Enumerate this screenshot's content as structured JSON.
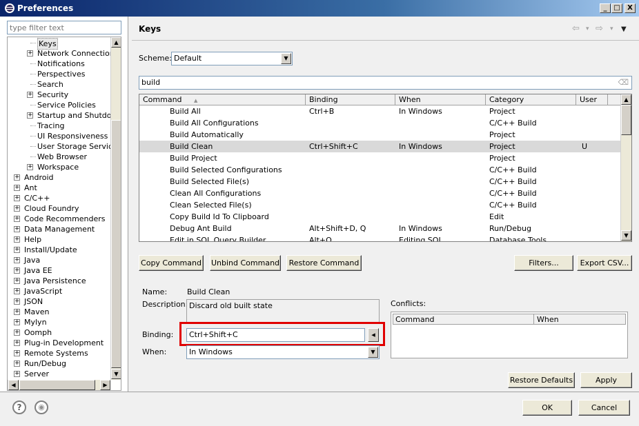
{
  "window": {
    "title": "Preferences",
    "min_label": "_",
    "max_label": "□",
    "close_label": "X"
  },
  "filter": {
    "placeholder": "type filter text"
  },
  "tree": {
    "items": [
      {
        "label": "Keys",
        "level": 2,
        "expander": "",
        "selected": true
      },
      {
        "label": "Network Connections",
        "level": 2,
        "expander": "+"
      },
      {
        "label": "Notifications",
        "level": 2,
        "expander": ""
      },
      {
        "label": "Perspectives",
        "level": 2,
        "expander": ""
      },
      {
        "label": "Search",
        "level": 2,
        "expander": ""
      },
      {
        "label": "Security",
        "level": 2,
        "expander": "+"
      },
      {
        "label": "Service Policies",
        "level": 2,
        "expander": ""
      },
      {
        "label": "Startup and Shutdown",
        "level": 2,
        "expander": "+"
      },
      {
        "label": "Tracing",
        "level": 2,
        "expander": ""
      },
      {
        "label": "UI Responsiveness M",
        "level": 2,
        "expander": ""
      },
      {
        "label": "User Storage Service",
        "level": 2,
        "expander": ""
      },
      {
        "label": "Web Browser",
        "level": 2,
        "expander": ""
      },
      {
        "label": "Workspace",
        "level": 2,
        "expander": "+"
      },
      {
        "label": "Android",
        "level": 1,
        "expander": "+"
      },
      {
        "label": "Ant",
        "level": 1,
        "expander": "+"
      },
      {
        "label": "C/C++",
        "level": 1,
        "expander": "+"
      },
      {
        "label": "Cloud Foundry",
        "level": 1,
        "expander": "+"
      },
      {
        "label": "Code Recommenders",
        "level": 1,
        "expander": "+"
      },
      {
        "label": "Data Management",
        "level": 1,
        "expander": "+"
      },
      {
        "label": "Help",
        "level": 1,
        "expander": "+"
      },
      {
        "label": "Install/Update",
        "level": 1,
        "expander": "+"
      },
      {
        "label": "Java",
        "level": 1,
        "expander": "+"
      },
      {
        "label": "Java EE",
        "level": 1,
        "expander": "+"
      },
      {
        "label": "Java Persistence",
        "level": 1,
        "expander": "+"
      },
      {
        "label": "JavaScript",
        "level": 1,
        "expander": "+"
      },
      {
        "label": "JSON",
        "level": 1,
        "expander": "+"
      },
      {
        "label": "Maven",
        "level": 1,
        "expander": "+"
      },
      {
        "label": "Mylyn",
        "level": 1,
        "expander": "+"
      },
      {
        "label": "Oomph",
        "level": 1,
        "expander": "+"
      },
      {
        "label": "Plug-in Development",
        "level": 1,
        "expander": "+"
      },
      {
        "label": "Remote Systems",
        "level": 1,
        "expander": "+"
      },
      {
        "label": "Run/Debug",
        "level": 1,
        "expander": "+"
      },
      {
        "label": "Server",
        "level": 1,
        "expander": "+"
      }
    ]
  },
  "page": {
    "title": "Keys"
  },
  "nav": {
    "back": "⇦",
    "back_menu": "▾",
    "forward": "⇨",
    "forward_menu": "▾",
    "view_menu": "▼"
  },
  "scheme": {
    "label": "Scheme:",
    "value": "Default"
  },
  "search": {
    "value": "build",
    "clear_icon": "⌫"
  },
  "table": {
    "columns": [
      "Command",
      "Binding",
      "When",
      "Category",
      "User"
    ],
    "sort_indicator": "▲",
    "rows": [
      {
        "command": "Build All",
        "binding": "Ctrl+B",
        "when": "In Windows",
        "category": "Project",
        "user": ""
      },
      {
        "command": "Build All Configurations",
        "binding": "",
        "when": "",
        "category": "C/C++ Build",
        "user": ""
      },
      {
        "command": "Build Automatically",
        "binding": "",
        "when": "",
        "category": "Project",
        "user": ""
      },
      {
        "command": "Build Clean",
        "binding": "Ctrl+Shift+C",
        "when": "In Windows",
        "category": "Project",
        "user": "U",
        "selected": true
      },
      {
        "command": "Build Project",
        "binding": "",
        "when": "",
        "category": "Project",
        "user": ""
      },
      {
        "command": "Build Selected Configurations",
        "binding": "",
        "when": "",
        "category": "C/C++ Build",
        "user": ""
      },
      {
        "command": "Build Selected File(s)",
        "binding": "",
        "when": "",
        "category": "C/C++ Build",
        "user": ""
      },
      {
        "command": "Clean All Configurations",
        "binding": "",
        "when": "",
        "category": "C/C++ Build",
        "user": ""
      },
      {
        "command": "Clean Selected File(s)",
        "binding": "",
        "when": "",
        "category": "C/C++ Build",
        "user": ""
      },
      {
        "command": "Copy Build Id To Clipboard",
        "binding": "",
        "when": "",
        "category": "Edit",
        "user": ""
      },
      {
        "command": "Debug Ant Build",
        "binding": "Alt+Shift+D, Q",
        "when": "In Windows",
        "category": "Run/Debug",
        "user": ""
      },
      {
        "command": "Edit in SQL Query Builder",
        "binding": "Alt+Q",
        "when": "Editing SQL",
        "category": "Database Tools",
        "user": ""
      }
    ]
  },
  "buttons": {
    "copy": "Copy Command",
    "unbind": "Unbind Command",
    "restore": "Restore Command",
    "filters": "Filters...",
    "export": "Export CSV...",
    "restore_defaults": "Restore Defaults",
    "apply": "Apply",
    "ok": "OK",
    "cancel": "Cancel"
  },
  "details": {
    "name_label": "Name:",
    "name_value": "Build Clean",
    "description_label": "Description:",
    "description_value": "Discard old built state",
    "binding_label": "Binding:",
    "binding_value": "Ctrl+Shift+C",
    "binding_menu": "◂",
    "when_label": "When:",
    "when_value": "In Windows"
  },
  "conflicts": {
    "label": "Conflicts:",
    "columns": [
      "Command",
      "When"
    ]
  },
  "footer": {
    "help_icon": "?",
    "import_icon": "◉"
  }
}
